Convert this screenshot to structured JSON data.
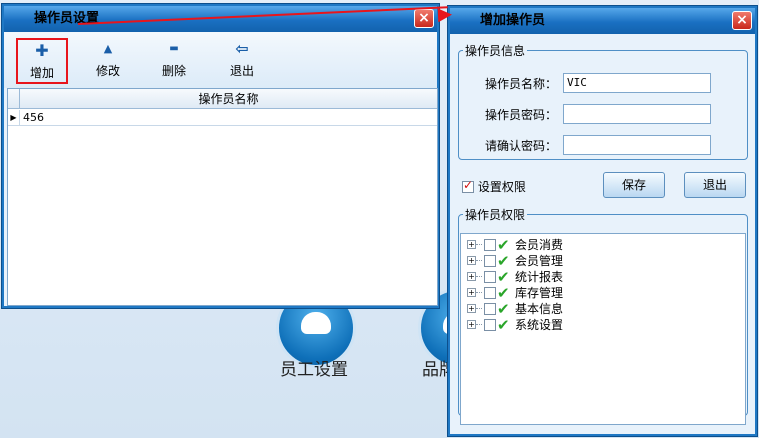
{
  "background": {
    "labels": [
      "员工设置",
      "品牌"
    ]
  },
  "operator_window": {
    "title": "操作员设置",
    "close": "×",
    "toolbar": [
      {
        "label": "增加",
        "icon": "plus-icon",
        "glyph": "✚"
      },
      {
        "label": "修改",
        "icon": "triangle-up-icon",
        "glyph": "▲"
      },
      {
        "label": "删除",
        "icon": "minus-icon",
        "glyph": "▬"
      },
      {
        "label": "退出",
        "icon": "exit-door-icon",
        "glyph": "⇦"
      }
    ],
    "grid": {
      "column": "操作员名称",
      "rows": [
        {
          "indicator": "▶",
          "name": "456"
        }
      ]
    }
  },
  "add_window": {
    "title": "增加操作员",
    "close": "×",
    "info_legend": "操作员信息",
    "fields": [
      {
        "label": "操作员名称：",
        "value": "VIC"
      },
      {
        "label": "操作员密码：",
        "value": ""
      },
      {
        "label": "请确认密码：",
        "value": ""
      }
    ],
    "set_permission": {
      "label": "设置权限",
      "checked": true,
      "tick": "✓"
    },
    "save_label": "保存",
    "exit_label": "退出",
    "perm_legend": "操作员权限",
    "tree": [
      {
        "label": "会员消费",
        "expander": "+",
        "check": "✔"
      },
      {
        "label": "会员管理",
        "expander": "+",
        "check": "✔"
      },
      {
        "label": "统计报表",
        "expander": "+",
        "check": "✔"
      },
      {
        "label": "库存管理",
        "expander": "+",
        "check": "✔"
      },
      {
        "label": "基本信息",
        "expander": "+",
        "check": "✔"
      },
      {
        "label": "系统设置",
        "expander": "+",
        "check": "✔"
      }
    ]
  },
  "colors": {
    "accent": "#1a70c2",
    "annotation": "#e8151c",
    "check_green": "#2aa52a"
  }
}
